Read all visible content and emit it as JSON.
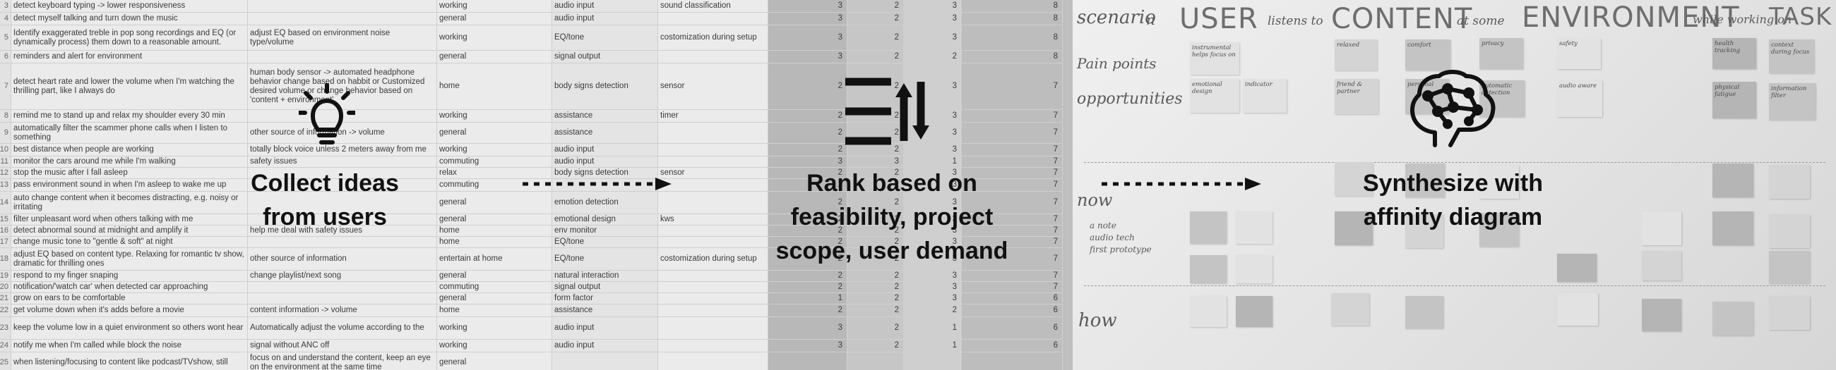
{
  "spreadsheet": {
    "rows": [
      {
        "num": "3",
        "text": "detect keyboard typing -> lower responsiveness",
        "info": "",
        "env": "working",
        "cat": "audio input",
        "tech": "sound classification",
        "s1": "3",
        "s2": "2",
        "s3": "3",
        "s4": "8",
        "h": 18
      },
      {
        "num": "4",
        "text": "detect myself talking and turn down the music",
        "info": "",
        "env": "general",
        "cat": "audio input",
        "tech": "",
        "s1": "3",
        "s2": "2",
        "s3": "3",
        "s4": "8",
        "h": 18
      },
      {
        "num": "5",
        "text": "Identify exaggerated treble in pop song recordings and EQ (or dynamically process) them down to a reasonable amount.",
        "info": "adjust EQ based on environment noise type/volume",
        "env": "working",
        "cat": "EQ/tone",
        "tech": "costomization during setup",
        "s1": "3",
        "s2": "2",
        "s3": "3",
        "s4": "8",
        "h": 36
      },
      {
        "num": "6",
        "text": "reminders and alert for environment",
        "info": "",
        "env": "general",
        "cat": "signal output",
        "tech": "",
        "s1": "3",
        "s2": "2",
        "s3": "2",
        "s4": "8",
        "h": 18
      },
      {
        "num": "7",
        "text": "detect heart rate and lower the volume when I'm watching the thrilling part, like I always do",
        "info": "human body sensor -> automated  headphone behavior change based on habbit or Customized desired volume or change behavior based on 'content + environment'",
        "env": "home",
        "cat": "body signs detection",
        "tech": "sensor",
        "s1": "2",
        "s2": "2",
        "s3": "3",
        "s4": "7",
        "h": 66
      },
      {
        "num": "8",
        "text": "remind me to stand up and relax my shoulder every 30 min",
        "info": "",
        "env": "working",
        "cat": "assistance",
        "tech": "timer",
        "s1": "2",
        "s2": "2",
        "s3": "3",
        "s4": "7",
        "h": 18
      },
      {
        "num": "9",
        "text": "automatically filter the scammer phone calls when I listen to something",
        "info": "other source of information -> volume",
        "env": "general",
        "cat": "assistance",
        "tech": "",
        "s1": "2",
        "s2": "2",
        "s3": "3",
        "s4": "7",
        "h": 30
      },
      {
        "num": "10",
        "text": "best distance when people are working",
        "info": "totally block voice unless 2 meters away from me",
        "env": "working",
        "cat": "audio input",
        "tech": "",
        "s1": "2",
        "s2": "2",
        "s3": "3",
        "s4": "7",
        "h": 18
      },
      {
        "num": "11",
        "text": "monitor the cars around me while I'm walking",
        "info": "safety issues",
        "env": "commuting",
        "cat": "audio input",
        "tech": "",
        "s1": "3",
        "s2": "3",
        "s3": "1",
        "s4": "7",
        "h": 16
      },
      {
        "num": "12",
        "text": "stop the music after I fall asleep",
        "info": "",
        "env": "relax",
        "cat": "body signs detection",
        "tech": "sensor",
        "s1": "2",
        "s2": "2",
        "s3": "3",
        "s4": "7",
        "h": 16
      },
      {
        "num": "13",
        "text": "pass environment sound in when I'm asleep to wake me up",
        "info": "",
        "env": "commuting",
        "cat": "",
        "tech": "",
        "s1": "2",
        "s2": "2",
        "s3": "3",
        "s4": "7",
        "h": 18
      },
      {
        "num": "14",
        "text": "auto change content when it becomes distracting, e.g. noisy or irritating",
        "info": "",
        "env": "general",
        "cat": "emotion detection",
        "tech": "",
        "s1": "2",
        "s2": "2",
        "s3": "3",
        "s4": "7",
        "h": 32
      },
      {
        "num": "15",
        "text": "filter unpleasant word when others talking with me",
        "info": "",
        "env": "general",
        "cat": "emotional design",
        "tech": "kws",
        "s1": "2",
        "s2": "2",
        "s3": "3",
        "s4": "7",
        "h": 16
      },
      {
        "num": "16",
        "text": "detect abnormal sound at midnight and amplify it",
        "info": "help me deal with safety issues",
        "env": "home",
        "cat": "env monitor",
        "tech": "",
        "s1": "2",
        "s2": "2",
        "s3": "3",
        "s4": "7",
        "h": 16
      },
      {
        "num": "17",
        "text": "change music tone to \"gentle & soft\" at night",
        "info": "",
        "env": "home",
        "cat": "EQ/tone",
        "tech": "",
        "s1": "2",
        "s2": "2",
        "s3": "3",
        "s4": "7",
        "h": 16
      },
      {
        "num": "18",
        "text": "adjust EQ based on content type. Relaxing for romantic tv show, dramatic for thrilling ones",
        "info": "other source of information",
        "env": "entertain at home",
        "cat": "EQ/tone",
        "tech": "costomization during setup",
        "s1": "2",
        "s2": "2",
        "s3": "3",
        "s4": "7",
        "h": 32
      },
      {
        "num": "19",
        "text": "respond to my finger snaping",
        "info": "change playlist/next song",
        "env": "general",
        "cat": "natural interaction",
        "tech": "",
        "s1": "2",
        "s2": "2",
        "s3": "3",
        "s4": "7",
        "h": 16
      },
      {
        "num": "20",
        "text": "notification/'watch car' when detected car approaching",
        "info": "",
        "env": "commuting",
        "cat": "signal output",
        "tech": "",
        "s1": "2",
        "s2": "2",
        "s3": "3",
        "s4": "7",
        "h": 16
      },
      {
        "num": "21",
        "text": "grow on ears to be comfortable",
        "info": "",
        "env": "general",
        "cat": "form factor",
        "tech": "",
        "s1": "1",
        "s2": "2",
        "s3": "3",
        "s4": "6",
        "h": 16
      },
      {
        "num": "22",
        "text": "get volume down when it's adds before a movie",
        "info": "content information -> volume",
        "env": "home",
        "cat": "assistance",
        "tech": "",
        "s1": "2",
        "s2": "2",
        "s3": "2",
        "s4": "6",
        "h": 18
      },
      {
        "num": "23",
        "text": "keep the volume low in a quiet environment so others wont hear",
        "info": "Automatically adjust the volume according to the",
        "env": "working",
        "cat": "audio input",
        "tech": "",
        "s1": "3",
        "s2": "2",
        "s3": "1",
        "s4": "6",
        "h": 32
      },
      {
        "num": "24",
        "text": "notify me when I'm called while block the noise",
        "info": "signal without ANC off",
        "env": "working",
        "cat": "audio input",
        "tech": "",
        "s1": "3",
        "s2": "2",
        "s3": "1",
        "s4": "6",
        "h": 18
      },
      {
        "num": "25",
        "text": "when listening/focusing to content like podcast/TVshow, still",
        "info": "focus on and understand the content, keep an eye on the environment at the same time",
        "env": "general",
        "cat": "",
        "tech": "",
        "s1": "",
        "s2": "",
        "s3": "",
        "s4": "",
        "h": 30
      }
    ]
  },
  "steps": {
    "collect": {
      "label": "Collect ideas from users"
    },
    "rank": {
      "label": "Rank based on feasibility, project scope, user demand"
    },
    "synthesize": {
      "label": "Synthesize with affinity diagram"
    }
  },
  "board": {
    "headline": {
      "scenario": "scenario",
      "n": "n",
      "user": "USER",
      "listens": "listens to",
      "content": "CONTENT",
      "atsome": "at some",
      "environment": "ENVIRONMENT",
      "while": "while working on",
      "task": "TASK"
    },
    "left_labels": {
      "pain_points": "Pain points",
      "opportunities": "opportunities",
      "now": "now",
      "how": "how"
    },
    "notes": [
      {
        "text": "a note",
        "cls": "c3"
      },
      {
        "text": "audio tech",
        "cls": "c3"
      },
      {
        "text": "first prototype",
        "cls": "c3"
      }
    ],
    "sticky_notes": [
      {
        "text": "instrumental helps focus on",
        "cls": "c3"
      },
      {
        "text": "relaxed",
        "cls": "c1"
      },
      {
        "text": "comfort",
        "cls": "c2"
      },
      {
        "text": "privacy",
        "cls": "c2"
      },
      {
        "text": "safety",
        "cls": "c3"
      },
      {
        "text": "health tracking",
        "cls": "c4"
      },
      {
        "text": "context during focus",
        "cls": "c2"
      },
      {
        "text": "emotional design",
        "cls": "c3"
      },
      {
        "text": "indicator",
        "cls": "c3"
      },
      {
        "text": "friend & partner",
        "cls": "c1"
      },
      {
        "text": "personal",
        "cls": "c2"
      },
      {
        "text": "automatic detection",
        "cls": "c2"
      },
      {
        "text": "audio aware",
        "cls": "c3"
      },
      {
        "text": "physical fatigue",
        "cls": "c4"
      },
      {
        "text": "information filter",
        "cls": "c2"
      }
    ]
  }
}
